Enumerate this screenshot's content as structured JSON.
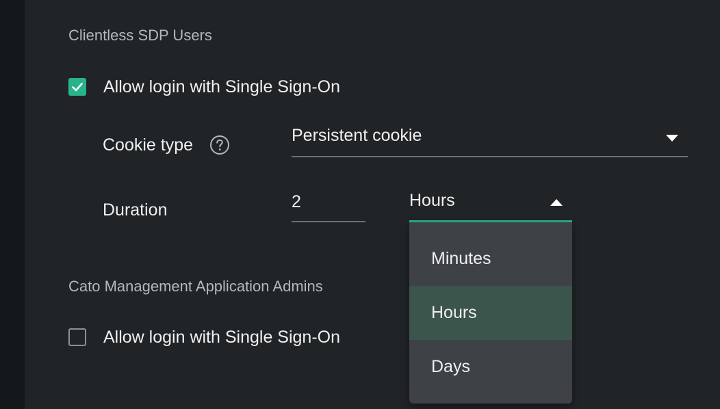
{
  "sdp_section": {
    "title": "Clientless SDP Users",
    "sso_checkbox": {
      "label": "Allow login with Single Sign-On",
      "checked": true
    },
    "cookie_type": {
      "label": "Cookie type",
      "help_icon": "help-circle-icon",
      "value": "Persistent cookie"
    },
    "duration": {
      "label": "Duration",
      "value": "2",
      "unit": "Hours",
      "options": [
        "Minutes",
        "Hours",
        "Days"
      ],
      "selected_option": "Hours"
    }
  },
  "admins_section": {
    "title": "Cato Management Application Admins",
    "sso_checkbox": {
      "label": "Allow login with Single Sign-On",
      "checked": false
    }
  },
  "colors": {
    "accent": "#29b38a",
    "background": "#212427",
    "menu_background": "#3e4246",
    "menu_selected": "#3b544c"
  }
}
